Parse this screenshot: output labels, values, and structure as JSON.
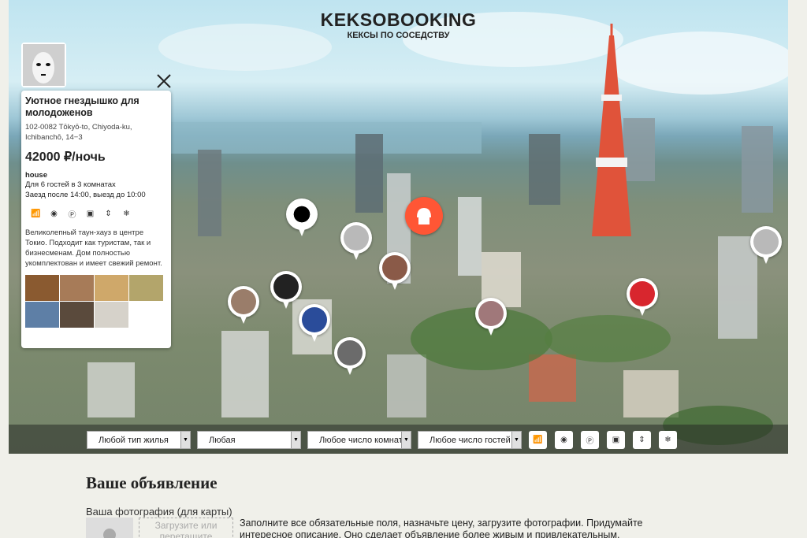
{
  "header": {
    "title": "KEKSOBOOKING",
    "subtitle": "КЕКСЫ ПО СОСЕДСТВУ"
  },
  "card": {
    "title": "Уютное гнездышко для молодоженов",
    "address": "102-0082 Tōkyō-to, Chiyoda-ku, Ichibanchō, 14−3",
    "price": "42000 ₽/ночь",
    "type": "house",
    "capacity": "Для 6 гостей в 3 комнатах",
    "checkin": "Заезд после 14:00, выезд до 10:00",
    "features": [
      "wifi-icon",
      "dishwasher-icon",
      "parking-icon",
      "washer-icon",
      "elevator-icon",
      "conditioner-icon"
    ],
    "description": "Великолепный таун-хауз в центре Токио. Подходит как туристам, так и бизнесменам. Дом полностью укомплектован и имеет свежий ремонт."
  },
  "filters": {
    "type": "Любой тип жилья",
    "price": "Любая",
    "rooms": "Любое число комнат",
    "guests": "Любое число гостей",
    "features": [
      "wifi-icon",
      "dishwasher-icon",
      "parking-icon",
      "washer-icon",
      "elevator-icon",
      "conditioner-icon"
    ]
  },
  "form": {
    "title": "Ваше объявление",
    "photo_label": "Ваша фотография (для карты)",
    "dropzone": "Загрузите или перетащите",
    "hint": "Заполните все обязательные поля, назначьте цену, загрузите фотографии. Придумайте интересное описание. Оно сделает объявление более живым и привлекательным."
  },
  "colors": {
    "accent": "#ff5635",
    "background": "#f0f0ea"
  }
}
